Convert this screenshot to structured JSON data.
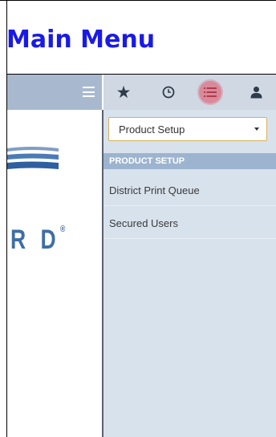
{
  "page": {
    "title": "Main Menu"
  },
  "toolbar": {
    "icons": [
      "hamburger-icon",
      "star-icon",
      "clock-icon",
      "list-icon",
      "user-icon"
    ]
  },
  "logo": {
    "text": "R D",
    "registered": "®"
  },
  "dropdown": {
    "selected": "Product Setup"
  },
  "menu": {
    "section_header": "PRODUCT SETUP",
    "items": [
      {
        "label": "District Print Queue"
      },
      {
        "label": "Secured Users"
      }
    ]
  },
  "colors": {
    "title": "#1a1ae6",
    "toolbar_left": "#a8b9cf",
    "toolbar_right": "#cfd8e3",
    "active_icon_bg": "#d88a9a",
    "section_header": "#9db4cf",
    "panel_bg": "#d8e2ec",
    "logo": "#3e6ea6"
  }
}
